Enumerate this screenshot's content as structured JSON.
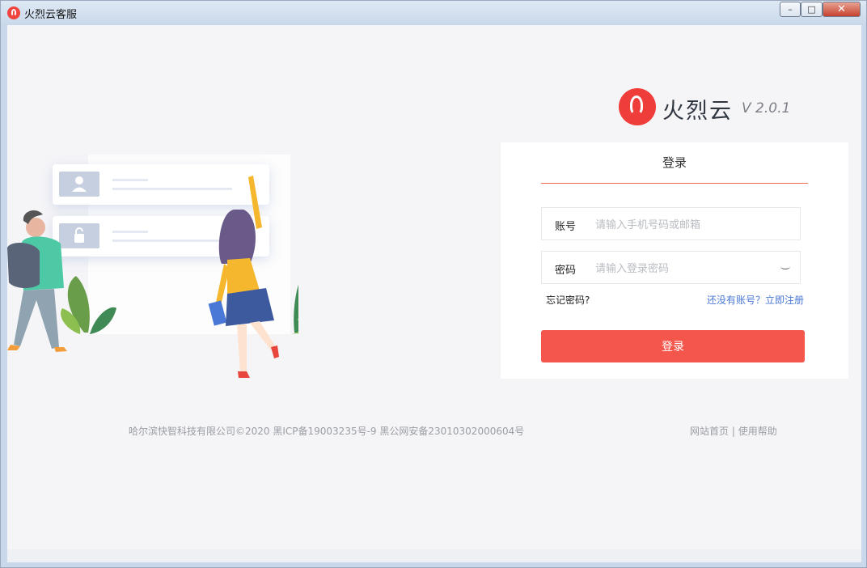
{
  "window": {
    "title": "火烈云客服",
    "minimize_glyph": "–",
    "maximize_glyph": "□",
    "close_glyph": "✕"
  },
  "brand": {
    "name": "火烈云",
    "version": "V 2.0.1",
    "logo_icon": "dragon-logo-icon",
    "accent_color": "#f5564b"
  },
  "login": {
    "tab_label": "登录",
    "account_label": "账号",
    "account_placeholder": "请输入手机号码或邮箱",
    "account_value": "",
    "password_label": "密码",
    "password_placeholder": "请输入登录密码",
    "password_value": "",
    "forgot_link": "忘记密码?",
    "register_link": "还没有账号？立即注册",
    "submit_label": "登录"
  },
  "footer": {
    "copyright": "哈尔滨快智科技有限公司©2020 黑ICP备19003235号-9 黑公网安备23010302000604号",
    "home_link": "网站首页",
    "separator": "|",
    "help_link": "使用帮助"
  }
}
